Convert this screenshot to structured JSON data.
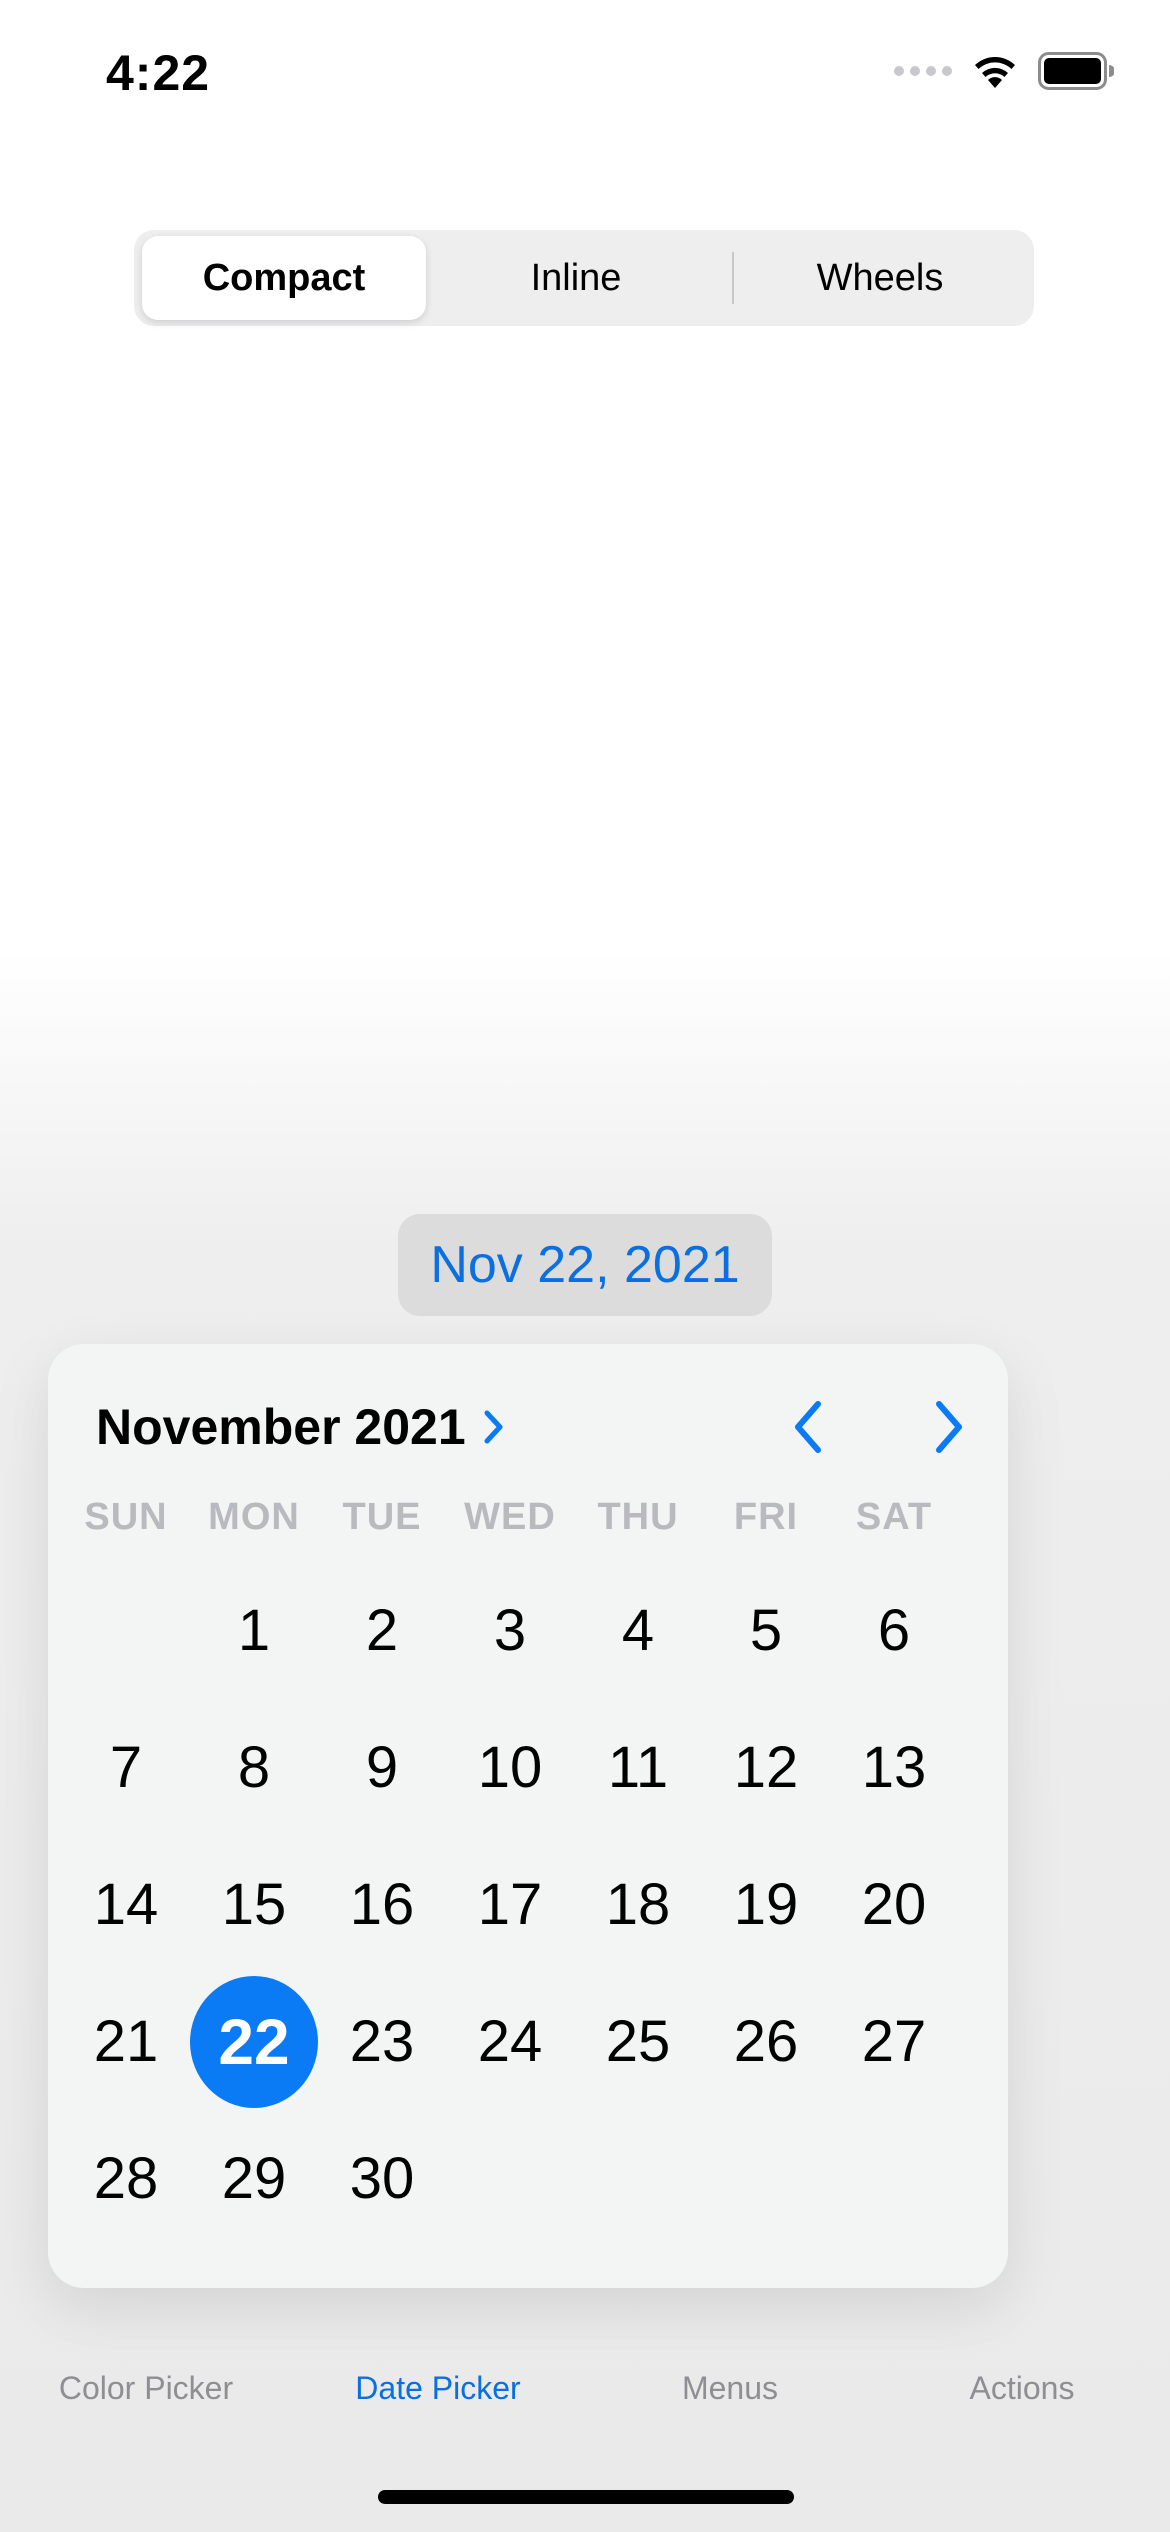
{
  "status_bar": {
    "time": "4:22",
    "icons": [
      "signal-dots-icon",
      "wifi-icon",
      "battery-icon"
    ]
  },
  "segmented": {
    "options": [
      "Compact",
      "Inline",
      "Wheels"
    ],
    "selected": "Compact"
  },
  "date_button": {
    "label": "Nov 22, 2021"
  },
  "calendar": {
    "month_label": "November 2021",
    "weekdays": [
      "SUN",
      "MON",
      "TUE",
      "WED",
      "THU",
      "FRI",
      "SAT"
    ],
    "selected_day": "22",
    "days": [
      "",
      "1",
      "2",
      "3",
      "4",
      "5",
      "6",
      "7",
      "8",
      "9",
      "10",
      "11",
      "12",
      "13",
      "14",
      "15",
      "16",
      "17",
      "18",
      "19",
      "20",
      "21",
      "22",
      "23",
      "24",
      "25",
      "26",
      "27",
      "28",
      "29",
      "30",
      "",
      "",
      "",
      ""
    ]
  },
  "tabs": [
    {
      "label": "Color Picker"
    },
    {
      "label": "Date Picker"
    },
    {
      "label": "Menus"
    },
    {
      "label": "Actions"
    }
  ],
  "active_tab": "Date Picker",
  "colors": {
    "accent": "#0a7bf5",
    "accent_text": "#0a6fe0",
    "inactive_tab": "#8e8e93",
    "weekday_label": "#b9b9be"
  }
}
